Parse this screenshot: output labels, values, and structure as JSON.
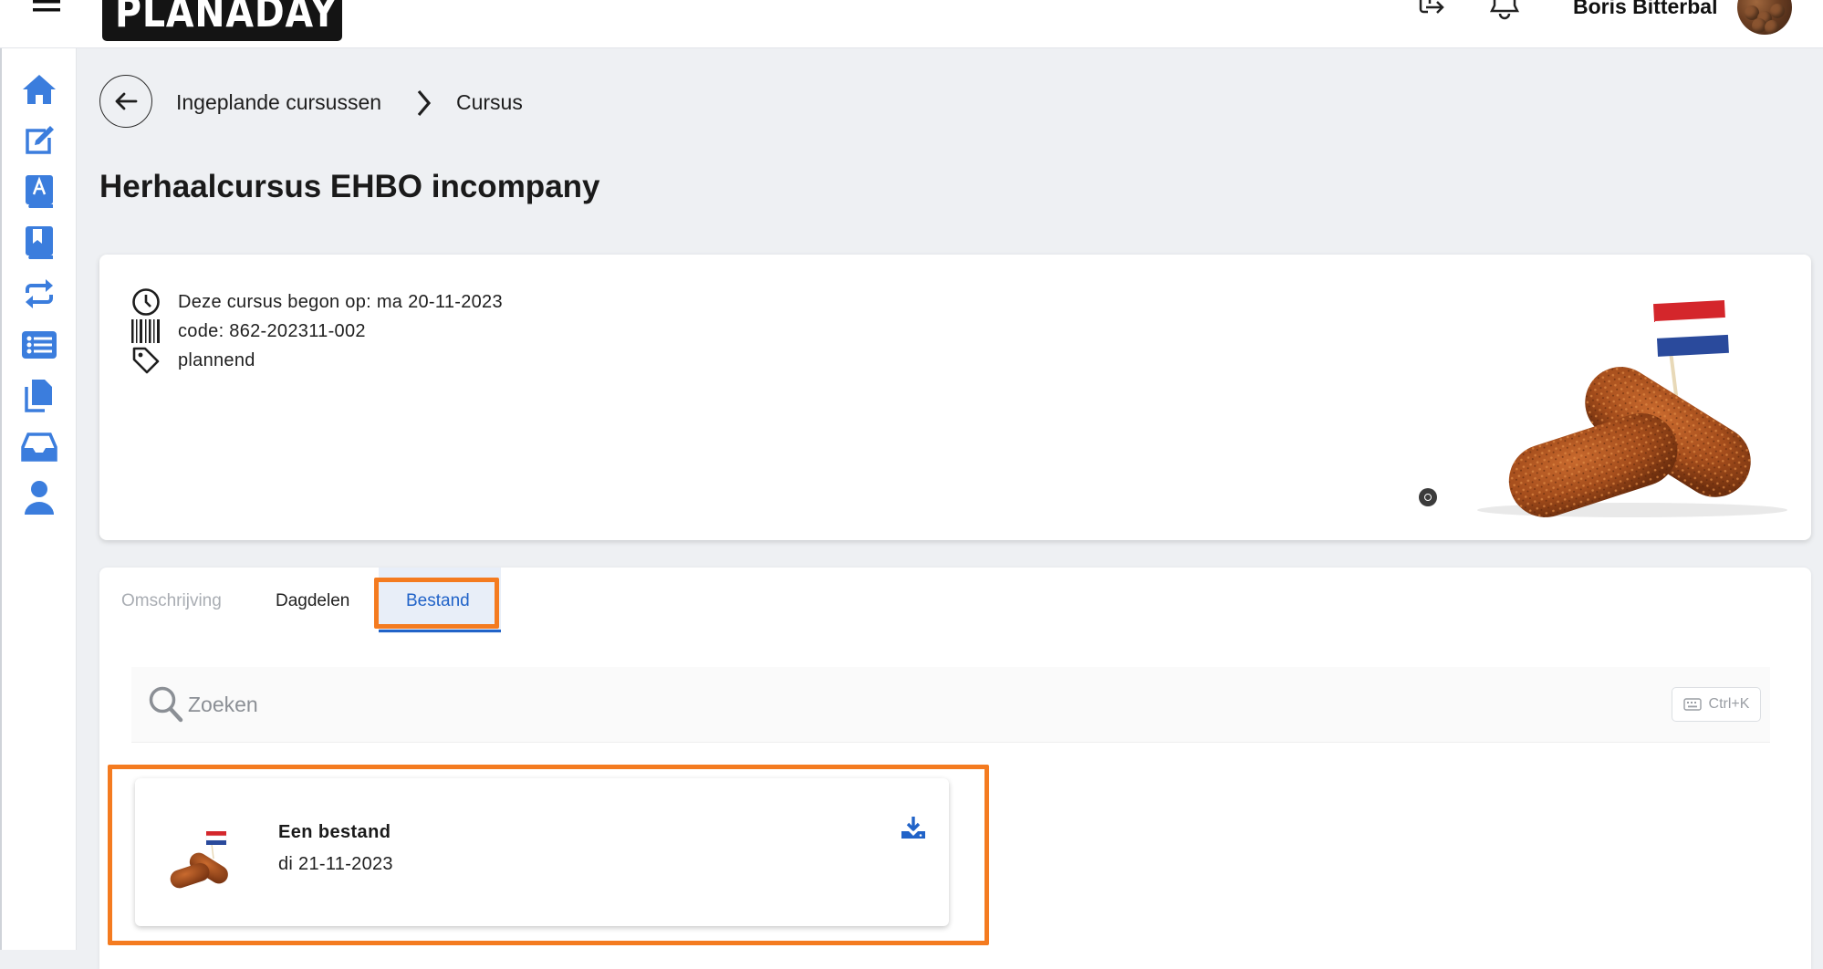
{
  "header": {
    "logo_text": "PLANADAY",
    "user_name": "Boris Bitterbal",
    "icons": [
      "menu-icon",
      "logout-icon",
      "bell-icon"
    ]
  },
  "sidebar": {
    "items": [
      {
        "icon": "home-icon"
      },
      {
        "icon": "edit-icon"
      },
      {
        "icon": "book-icon"
      },
      {
        "icon": "bookmark-book-icon"
      },
      {
        "icon": "repeat-icon"
      },
      {
        "icon": "list-icon"
      },
      {
        "icon": "copy-icon"
      },
      {
        "icon": "inbox-icon"
      },
      {
        "icon": "user-icon"
      }
    ],
    "accent_color": "#3b7ddd"
  },
  "breadcrumb": {
    "items": [
      "Ingeplande cursussen",
      "Cursus"
    ]
  },
  "page": {
    "title": "Herhaalcursus EHBO incompany"
  },
  "course_info": {
    "start": "Deze cursus begon op: ma 20-11-2023",
    "code": "code: 862-202311-002",
    "status": "plannend"
  },
  "tabs": {
    "items": [
      "Omschrijving",
      "Dagdelen",
      "Bestand"
    ],
    "active": "Bestand",
    "active_color": "#2163c8",
    "highlight_color": "#f47b20"
  },
  "search": {
    "placeholder": "Zoeken",
    "shortcut": "Ctrl+K"
  },
  "files": [
    {
      "name": "Een bestand",
      "date": "di 21-11-2023"
    }
  ]
}
